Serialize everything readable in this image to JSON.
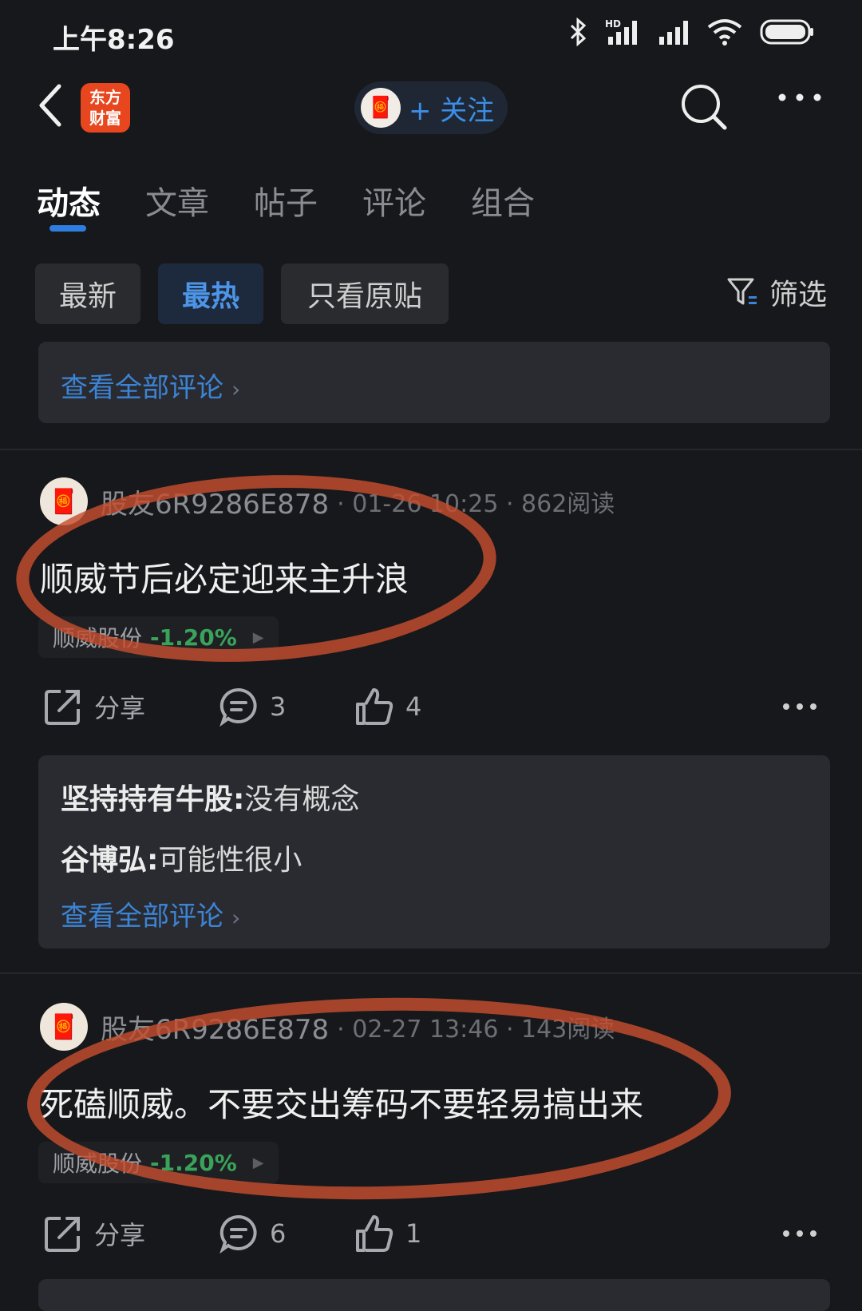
{
  "status_bar": {
    "time": "上午8:26",
    "icons": [
      "mute-icon",
      "alarm-icon",
      "bluetooth-icon",
      "hd-signal-icon",
      "signal-icon",
      "wifi-icon",
      "battery-icon"
    ]
  },
  "header": {
    "logo_line1": "东方",
    "logo_line2": "财富",
    "follow_label": "+ 关注"
  },
  "tabs": [
    {
      "label": "动态",
      "active": true
    },
    {
      "label": "文章"
    },
    {
      "label": "帖子"
    },
    {
      "label": "评论"
    },
    {
      "label": "组合"
    }
  ],
  "filters": {
    "chips": [
      "最新",
      "最热",
      "只看原贴"
    ],
    "active": "最热",
    "filter_label": "筛选"
  },
  "top_box": {
    "view_all": "查看全部评论"
  },
  "posts": [
    {
      "author": "股友6R9286E878",
      "meta": "· 01-26 10:25 · 862阅读",
      "text": "顺威节后必定迎来主升浪",
      "stock": "顺威股份",
      "change": "-1.20%",
      "share": "分享",
      "comments": "3",
      "likes": "4",
      "comment_box": {
        "lines": [
          {
            "user": "坚持持有牛股:",
            "text": "没有概念"
          },
          {
            "user": "谷博弘:",
            "text": "可能性很小"
          }
        ],
        "view_all": "查看全部评论"
      }
    },
    {
      "author": "股友6R9286E878",
      "meta": "· 02-27 13:46 · 143阅读",
      "text": "死磕顺威。不要交出筹码不要轻易搞出来",
      "stock": "顺威股份",
      "change": "-1.20%",
      "share": "分享",
      "comments": "6",
      "likes": "1"
    }
  ],
  "colors": {
    "accent": "#3c84d6",
    "loss_green": "#3aa35a",
    "logo": "#e8461f",
    "annotation": "#c44e30"
  }
}
